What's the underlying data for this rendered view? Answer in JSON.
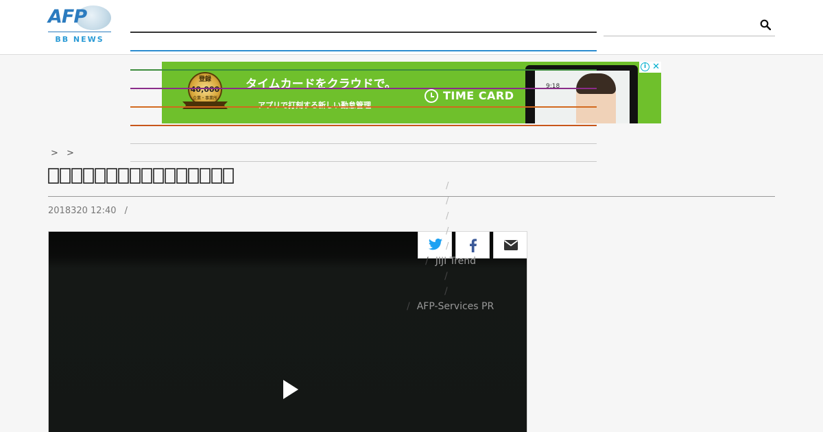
{
  "header": {
    "logo_text": "AFP",
    "logo_subtitle": "BB NEWS",
    "search_icon": "search-icon"
  },
  "nav_lines": {
    "main": "#333333",
    "accent": "#2a8bd0"
  },
  "ad": {
    "headline": "タイムカードをクラウドで。",
    "subline": "アプリで打刻する新しい勤怠管理",
    "brand": "TIME CARD",
    "badge_top": "登録",
    "badge_number": "40,000",
    "badge_foot": "企業・事業所",
    "tablet_time": "9:18",
    "info_icon": "info-icon",
    "close_icon": "close-icon",
    "background_color": "#6fc02c"
  },
  "breadcrumb": {
    "sep1": ">",
    "sep2": ">"
  },
  "article": {
    "title": "",
    "date": "2018320 12:40",
    "date_separator": "/"
  },
  "video": {
    "play_icon": "play-icon"
  },
  "share": {
    "twitter_icon": "twitter-icon",
    "facebook_icon": "facebook-icon",
    "email_icon": "email-icon",
    "twitter_color": "#1da1f2",
    "facebook_color": "#3b5998"
  },
  "menu": {
    "items": [
      {
        "sep": "/",
        "label": "JIJI Trend"
      },
      {
        "sep": "/",
        "label": ""
      },
      {
        "sep": "/",
        "label": ""
      },
      {
        "sep": "/",
        "label": "AFP-Services PR"
      }
    ],
    "faint_slashes": [
      "/",
      "/",
      "/",
      "/",
      "/"
    ]
  },
  "overlay_lines": {
    "green": "#3c8c3c",
    "purple": "#8a2c8a",
    "orange": "#d2691e",
    "orange2": "#c8561a"
  }
}
